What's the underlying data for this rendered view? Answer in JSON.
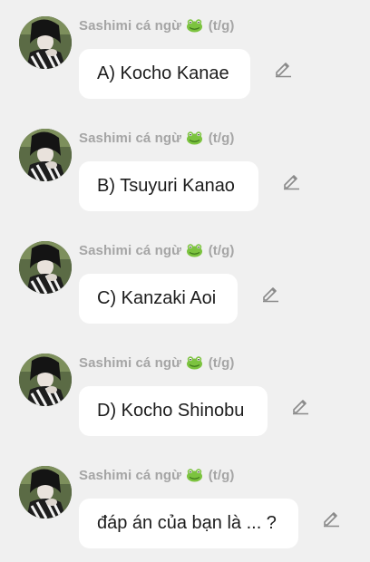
{
  "messages": [
    {
      "sender": "Sashimi cá ngừ",
      "sender_suffix": "(t/g)",
      "text": "A) Kocho Kanae"
    },
    {
      "sender": "Sashimi cá ngừ",
      "sender_suffix": "(t/g)",
      "text": "B) Tsuyuri Kanao"
    },
    {
      "sender": "Sashimi cá ngừ",
      "sender_suffix": "(t/g)",
      "text": "C) Kanzaki Aoi"
    },
    {
      "sender": "Sashimi cá ngừ",
      "sender_suffix": "(t/g)",
      "text": "D) Kocho Shinobu"
    },
    {
      "sender": "Sashimi cá ngừ",
      "sender_suffix": "(t/g)",
      "text": "đáp án của bạn là ... ?"
    }
  ],
  "icons": {
    "sender_emoji": "frog-icon",
    "edit": "pencil-icon"
  },
  "colors": {
    "background": "#f0f0f0",
    "bubble": "#ffffff",
    "sender_name": "#a5a5a5",
    "message_text": "#1c1c1c",
    "edit_icon": "#8a8a8a"
  }
}
